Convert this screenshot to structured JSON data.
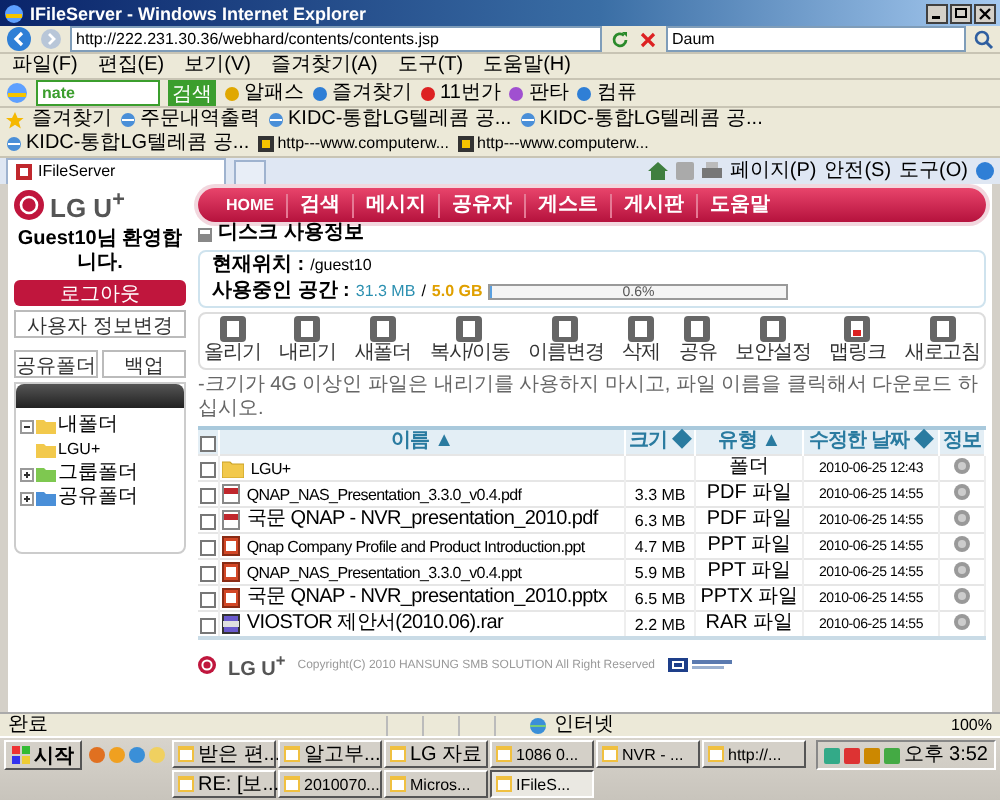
{
  "window": {
    "title": "IFileServer - Windows Internet Explorer"
  },
  "address_bar": {
    "url": "http://222.231.30.36/webhard/contents/contents.jsp",
    "search": "Daum"
  },
  "menu": [
    "파일(F)",
    "편집(E)",
    "보기(V)",
    "즐겨찾기(A)",
    "도구(T)",
    "도움말(H)"
  ],
  "toolbar": {
    "search_value": "nate",
    "search_button": "검색",
    "items": [
      "알패스",
      "즐겨찾기",
      "11번가",
      "판타",
      "컴퓨"
    ]
  },
  "favorites": [
    "즐겨찾기",
    "주문내역출력",
    "KIDC-통합LG텔레콤 공...",
    "KIDC-통합LG텔레콤 공...",
    "KIDC-통합LG텔레콤 공...",
    "http---www.computerw...",
    "http---www.computerw..."
  ],
  "tab": {
    "title": "IFileServer"
  },
  "commands": [
    "페이지(P)",
    "안전(S)",
    "도구(O)"
  ],
  "page": {
    "logo": "LG U$^{+}$",
    "nav": [
      "HOME",
      "검색",
      "메시지",
      "공유자",
      "게스트",
      "게시판",
      "도움말"
    ],
    "welcome": "Guest10님 환영합니다.",
    "logout": "로그아웃",
    "profile": "사용자 정보변경",
    "side_tabs": [
      {
        "label": "공유폴더",
        "selected": false
      },
      {
        "label": "백업",
        "selected": false
      }
    ],
    "tree": [
      {
        "label": "내폴더",
        "expanded": true,
        "children": [
          {
            "label": "LGU+"
          }
        ]
      },
      {
        "label": "그룹폴더",
        "expanded": false
      },
      {
        "label": "공유폴더",
        "expanded": false
      }
    ],
    "disk": {
      "title": "디스크 사용정보",
      "location_label": "현재위치 :",
      "location": "/guest10",
      "usage_label": "사용중인 공간 :",
      "used": "31.3 MB",
      "separator": "/",
      "total": "5.0 GB",
      "level": 0.006,
      "reading": "0.6%"
    },
    "actions": [
      "올리기",
      "내리기",
      "새폴더",
      "복사/이동",
      "이름변경",
      "삭제",
      "공유",
      "보안설정",
      "맵링크",
      "새로고침"
    ],
    "notice": "-크기가 4G 이상인 파일은 내리기를 사용하지 마시고, 파일 이름을 클릭해서 다운로드 하십시오.",
    "all_checked": false,
    "columns": [
      {
        "label": "이름",
        "sort_mark": "▲"
      },
      {
        "label": "크기",
        "sort_mark": "◆"
      },
      {
        "label": "유형",
        "sort_mark": "▲"
      },
      {
        "label": "수정한 날짜",
        "sort_mark": "◆"
      },
      {
        "label": "정보"
      }
    ],
    "rows": [
      {
        "name": "LGU+",
        "kind": "folder",
        "size": "",
        "type": "폴더",
        "date": "2010-06-25 12:43",
        "checked": false
      },
      {
        "name": "QNAP_NAS_Presentation_3.3.0_v0.4.pdf",
        "kind": "pdf",
        "size": "3.3 MB",
        "type": "PDF 파일",
        "date": "2010-06-25 14:55",
        "checked": false
      },
      {
        "name": "국문 QNAP - NVR_presentation_2010.pdf",
        "kind": "pdf",
        "size": "6.3 MB",
        "type": "PDF 파일",
        "date": "2010-06-25 14:55",
        "checked": false
      },
      {
        "name": "Qnap Company Profile and Product Introduction.ppt",
        "kind": "ppt",
        "size": "4.7 MB",
        "type": "PPT 파일",
        "date": "2010-06-25 14:55",
        "checked": false
      },
      {
        "name": "QNAP_NAS_Presentation_3.3.0_v0.4.ppt",
        "kind": "ppt",
        "size": "5.9 MB",
        "type": "PPT 파일",
        "date": "2010-06-25 14:55",
        "checked": false
      },
      {
        "name": "국문 QNAP - NVR_presentation_2010.pptx",
        "kind": "ppt",
        "size": "6.5 MB",
        "type": "PPTX 파일",
        "date": "2010-06-25 14:55",
        "checked": false
      },
      {
        "name": "VIOSTOR 제안서(2010.06).rar",
        "kind": "rar",
        "size": "2.2 MB",
        "type": "RAR 파일",
        "date": "2010-06-25 14:55",
        "checked": false
      }
    ],
    "footer": {
      "logo": "LG U$^{+}$",
      "copyright": "Copyright(C) 2010 HANSUNG SMB SOLUTION All Right Reserved"
    }
  },
  "status_bar": {
    "text": "완료",
    "zone": "인터넷",
    "zoom": "100%"
  },
  "taskbar": {
    "start": "시작",
    "items": [
      {
        "label": "받은 편...",
        "selected": false
      },
      {
        "label": "알고부...",
        "selected": false
      },
      {
        "label": "LG 자료",
        "selected": false
      },
      {
        "label": "1086 0...",
        "selected": false
      },
      {
        "label": "NVR - ...",
        "selected": false
      },
      {
        "label": "http://...",
        "selected": false
      },
      {
        "label": "RE: [보...",
        "selected": false
      },
      {
        "label": "2010070...",
        "selected": false
      },
      {
        "label": "Micros...",
        "selected": false
      },
      {
        "label": "IFileS...",
        "selected": true
      }
    ],
    "clock": "오후 3:52"
  }
}
